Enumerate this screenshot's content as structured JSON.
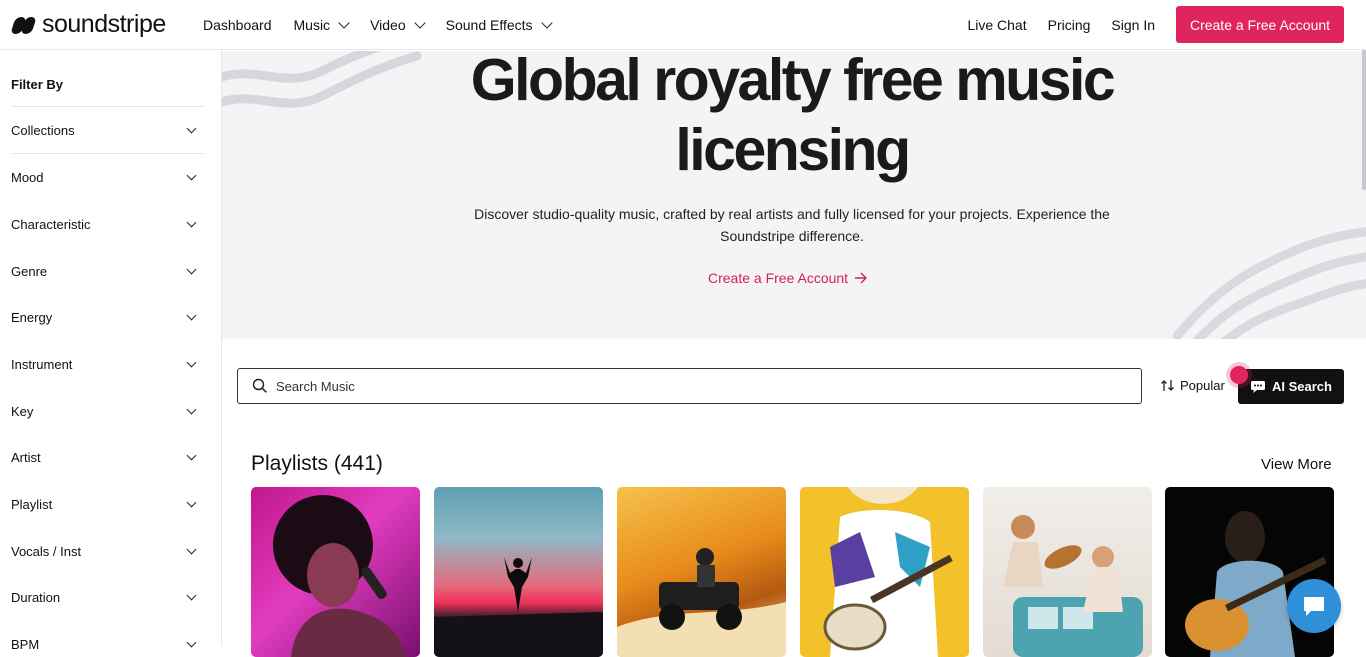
{
  "brand": {
    "name": "soundstripe"
  },
  "nav": {
    "items": [
      {
        "label": "Dashboard",
        "dropdown": false
      },
      {
        "label": "Music",
        "dropdown": true
      },
      {
        "label": "Video",
        "dropdown": true
      },
      {
        "label": "Sound Effects",
        "dropdown": true
      }
    ],
    "right": {
      "live_chat": "Live Chat",
      "pricing": "Pricing",
      "sign_in": "Sign In",
      "cta": "Create a Free Account"
    }
  },
  "sidebar": {
    "title": "Filter By",
    "items": [
      "Collections",
      "Mood",
      "Characteristic",
      "Genre",
      "Energy",
      "Instrument",
      "Key",
      "Artist",
      "Playlist",
      "Vocals / Inst",
      "Duration",
      "BPM"
    ]
  },
  "hero": {
    "title_line1": "Global royalty free music",
    "title_line2": "licensing",
    "description": "Discover studio-quality music, crafted by real artists and fully licensed for your projects. Experience the Soundstripe difference.",
    "cta": "Create a Free Account"
  },
  "search": {
    "placeholder": "Search Music",
    "value": ""
  },
  "sort": {
    "label": "Popular"
  },
  "ai_search": {
    "label": "AI Search"
  },
  "playlists": {
    "title": "Playlists (441)",
    "view_more": "View More",
    "cards": [
      {
        "name": "singer-magenta",
        "scene": "singer with microphone, magenta light"
      },
      {
        "name": "sunset-silhouette",
        "scene": "person with raised arms at sunset"
      },
      {
        "name": "atv-dunes",
        "scene": "rider on ATV in orange dunes"
      },
      {
        "name": "ukulele-player",
        "scene": "ukulele player on yellow background"
      },
      {
        "name": "van-friends",
        "scene": "friends on a vintage van with guitar"
      },
      {
        "name": "guitarist-dark",
        "scene": "guitarist on black background"
      }
    ]
  },
  "colors": {
    "accent": "#e0245e",
    "hero_bg": "#f4f4f7",
    "chat": "#2f8fd8",
    "dark": "#111111"
  },
  "icons": [
    "search-icon",
    "sort-icon",
    "ai-chat-icon",
    "arrow-right-icon",
    "chevron-down-icon",
    "chat-bubble-icon"
  ]
}
